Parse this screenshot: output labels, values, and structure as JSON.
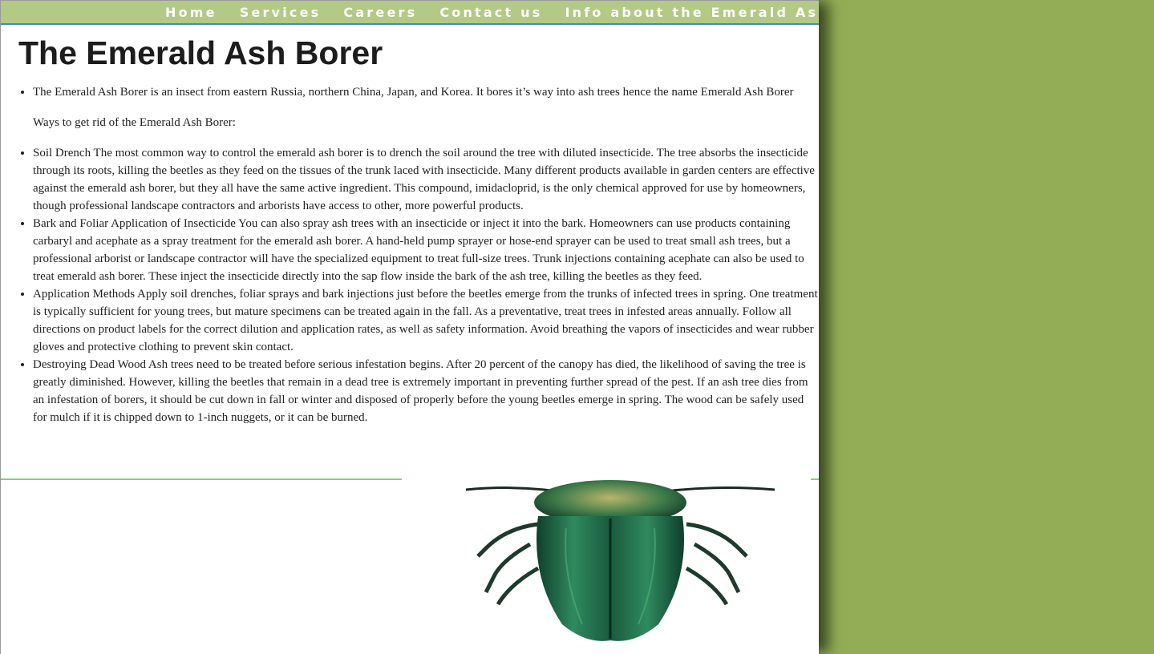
{
  "nav": {
    "items": [
      {
        "label": "Home"
      },
      {
        "label": "Services"
      },
      {
        "label": "Careers"
      },
      {
        "label": "Contact us"
      },
      {
        "label": "Info about the Emerald Ash Borer"
      }
    ]
  },
  "page": {
    "title": "The Emerald Ash Borer",
    "intro": "The Emerald Ash Borer is an insect from eastern Russia, northern China, Japan, and Korea. It bores it’s way into ash trees hence the name Emerald Ash Borer",
    "ways_heading": "Ways to get rid of the Emerald Ash Borer:",
    "methods": [
      {
        "text": "Soil Drench The most common way to control the emerald ash borer is to drench the soil around the tree with diluted insecticide. The tree absorbs the insecticide through its roots, killing the beetles as they feed on the tissues of the trunk laced with insecticide. Many different products available in garden centers are effective against the emerald ash borer, but they all have the same active ingredient. This compound, imidacloprid, is the only chemical approved for use by homeowners, though professional landscape contractors and arborists have access to other, more powerful products."
      },
      {
        "text": "Bark and Foliar Application of Insecticide You can also spray ash trees with an insecticide or inject it into the bark. Homeowners can use products containing carbaryl and acephate as a spray treatment for the emerald ash borer. A hand-held pump sprayer or hose-end sprayer can be used to treat small ash trees, but a professional arborist or landscape contractor will have the specialized equipment to treat full-size trees. Trunk injections containing acephate can also be used to treat emerald ash borer. These inject the insecticide directly into the sap flow inside the bark of the ash tree, killing the beetles as they feed."
      },
      {
        "text": "Application Methods Apply soil drenches, foliar sprays and bark injections just before the beetles emerge from the trunks of infected trees in spring. One treatment is typically sufficient for young trees, but mature specimens can be treated again in the fall. As a preventative, treat trees in infested areas annually. Follow all directions on product labels for the correct dilution and application rates, as well as safety information. Avoid breathing the vapors of insecticides and wear rubber gloves and protective clothing to prevent skin contact."
      },
      {
        "text": "Destroying Dead Wood Ash trees need to be treated before serious infestation begins. After 20 percent of the canopy has died, the likelihood of saving the tree is greatly diminished. However, killing the beetles that remain in a dead tree is extremely important in preventing further spread of the pest. If an ash tree dies from an infestation of borers, it should be cut down in fall or winter and disposed of properly before the young beetles emerge in spring. The wood can be safely used for mulch if it is chipped down to 1-inch nuggets, or it can be burned."
      }
    ]
  },
  "colors": {
    "background": "#93ad57",
    "navbar": "#b3c986",
    "nav_border": "#3d8fa3",
    "divider": "#7fd27f",
    "beetle": "#1f6b4a"
  },
  "image": {
    "name": "emerald-ash-borer-beetle"
  }
}
